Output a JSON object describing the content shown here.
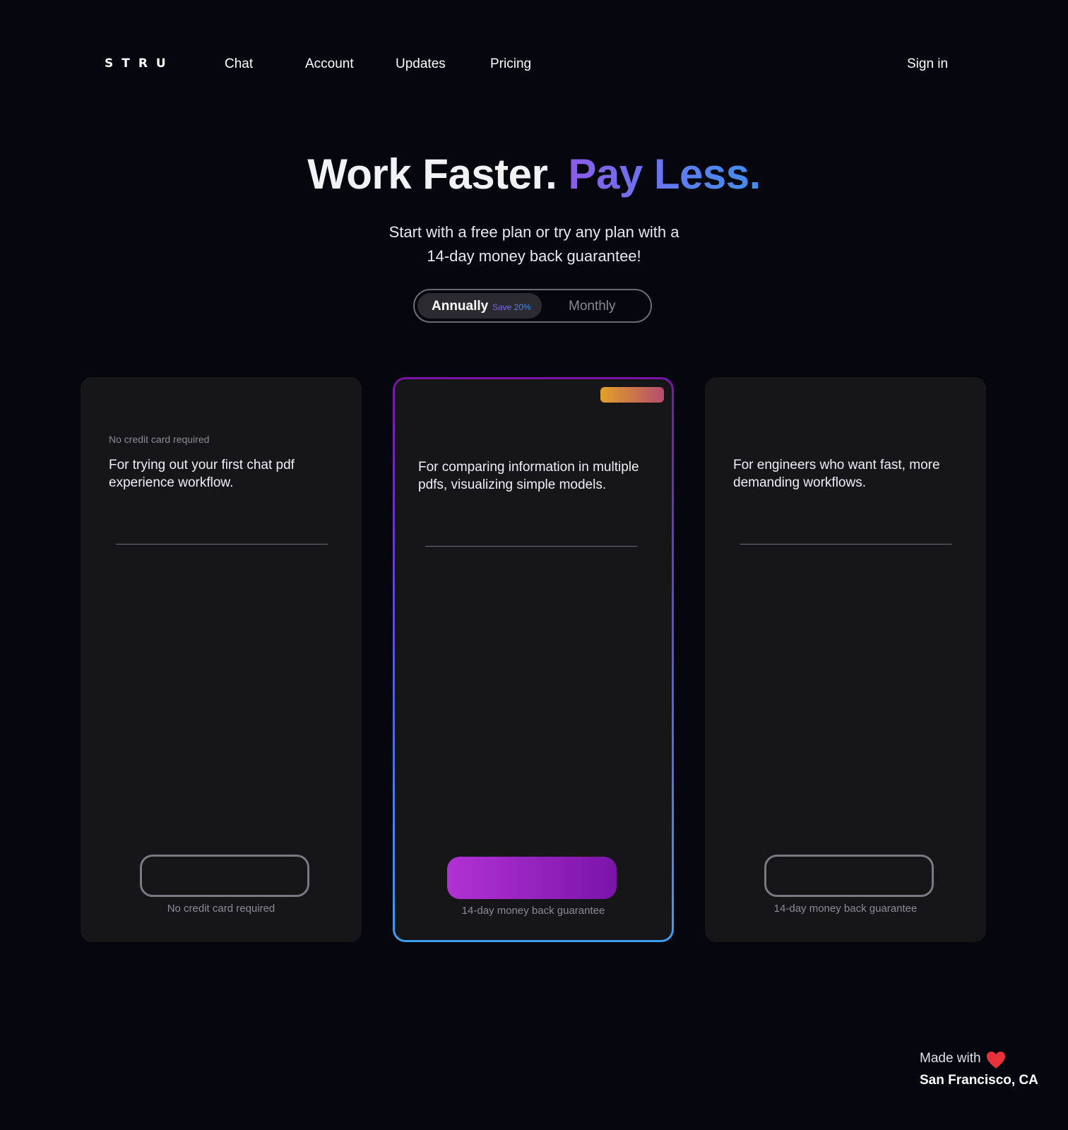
{
  "nav": {
    "logo": "STRU",
    "links": [
      "Chat",
      "Account",
      "Updates",
      "Pricing"
    ],
    "sign_in": "Sign in"
  },
  "hero": {
    "title_plain": "Work Faster.",
    "title_accent": "Pay Less.",
    "subtitle_line1": "Start with a free plan or try any plan with a",
    "subtitle_line2": "14-day money back guarantee!"
  },
  "billing_toggle": {
    "annual_label": "Annually",
    "annual_badge": "Save 20%",
    "monthly_label": "Monthly",
    "selected": "Annually"
  },
  "plans": [
    {
      "kicker": "No credit card required",
      "description": "For trying out your first chat pdf experience workflow.",
      "cta_label": "",
      "footnote": "No credit card required",
      "featured": false
    },
    {
      "kicker": "",
      "description": "For comparing information in multiple pdfs, visualizing simple models.",
      "cta_label": "",
      "footnote": "14-day money back guarantee",
      "featured": true
    },
    {
      "kicker": "",
      "description": "For engineers who want fast, more demanding workflows.",
      "cta_label": "",
      "footnote": "14-day money back guarantee",
      "featured": false
    }
  ],
  "footer": {
    "made_with": "Made with",
    "heart_icon": "heart-icon",
    "location": "San Francisco, CA"
  },
  "colors": {
    "background": "#06060f",
    "card": "#161618",
    "accent_purple": "#8c5ce8",
    "accent_blue": "#3f8ff0",
    "cta_gradient_start": "#b132d4",
    "cta_gradient_end": "#7a14a8",
    "badge_gradient_start": "#e3a027",
    "badge_gradient_end": "#b44d6e",
    "heart": "#e8323a"
  }
}
